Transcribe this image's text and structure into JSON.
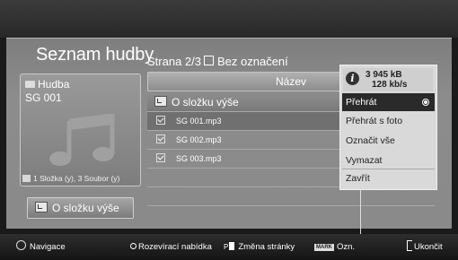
{
  "screen": {
    "title": "Seznam hudby"
  },
  "header": {
    "page_label": "Strana 2/3",
    "unmarked_label": "Bez označení"
  },
  "info_card": {
    "folder_name": "Hudba",
    "item_name": "SG 001",
    "counts": "1 Složka (y), 3 Soubor (y)"
  },
  "up_button": {
    "label": "O složku výše"
  },
  "list": {
    "column_header": "Název",
    "folder_row": "O složku výše",
    "files": [
      {
        "name": "SG 001.mp3",
        "checked": true
      },
      {
        "name": "SG 002.mp3",
        "checked": true
      },
      {
        "name": "SG 003.mp3",
        "checked": true
      }
    ]
  },
  "popup": {
    "file_size": "3 945 kB",
    "bitrate": "128 kb/s",
    "items": [
      {
        "label": "Přehrát",
        "selected": true
      },
      {
        "label": "Přehrát s foto",
        "selected": false
      },
      {
        "label": "Označit vše",
        "selected": false
      },
      {
        "label": "Vymazat",
        "selected": false
      },
      {
        "label": "Zavřít",
        "selected": false
      }
    ]
  },
  "footer": {
    "navigate": "Navigace",
    "popup_menu": "Rozevírací nabídka",
    "page_change": "Změna stránky",
    "mark_key": "MARK",
    "mark": "Ozn.",
    "exit": "Ukončit"
  },
  "colors": {
    "panel": "#8a8a8a",
    "selected": "#2a2a2a",
    "popup": "#d9d9d9"
  }
}
